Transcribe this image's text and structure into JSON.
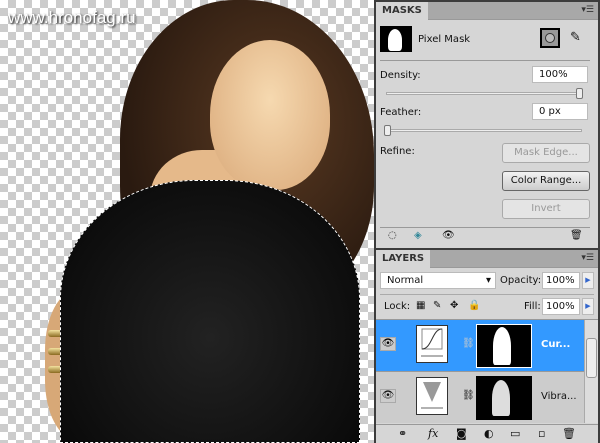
{
  "watermark": "www.hronofag.ru",
  "masks": {
    "tab": "MASKS",
    "mask_type": "Pixel Mask",
    "density_label": "Density:",
    "density_value": "100%",
    "density_fraction": 1.0,
    "feather_label": "Feather:",
    "feather_value": "0 px",
    "feather_fraction": 0.0,
    "refine_label": "Refine:",
    "mask_edge": "Mask Edge...",
    "color_range": "Color Range...",
    "invert": "Invert"
  },
  "layers": {
    "tab": "LAYERS",
    "blend_mode": "Normal",
    "opacity_label": "Opacity:",
    "opacity_value": "100%",
    "lock_label": "Lock:",
    "fill_label": "Fill:",
    "fill_value": "100%",
    "items": [
      {
        "name": "Cur...",
        "selected": true
      },
      {
        "name": "Vibra...",
        "selected": false
      }
    ]
  },
  "colors": {
    "selection": "#3399ff",
    "panel": "#d6d6d6"
  }
}
